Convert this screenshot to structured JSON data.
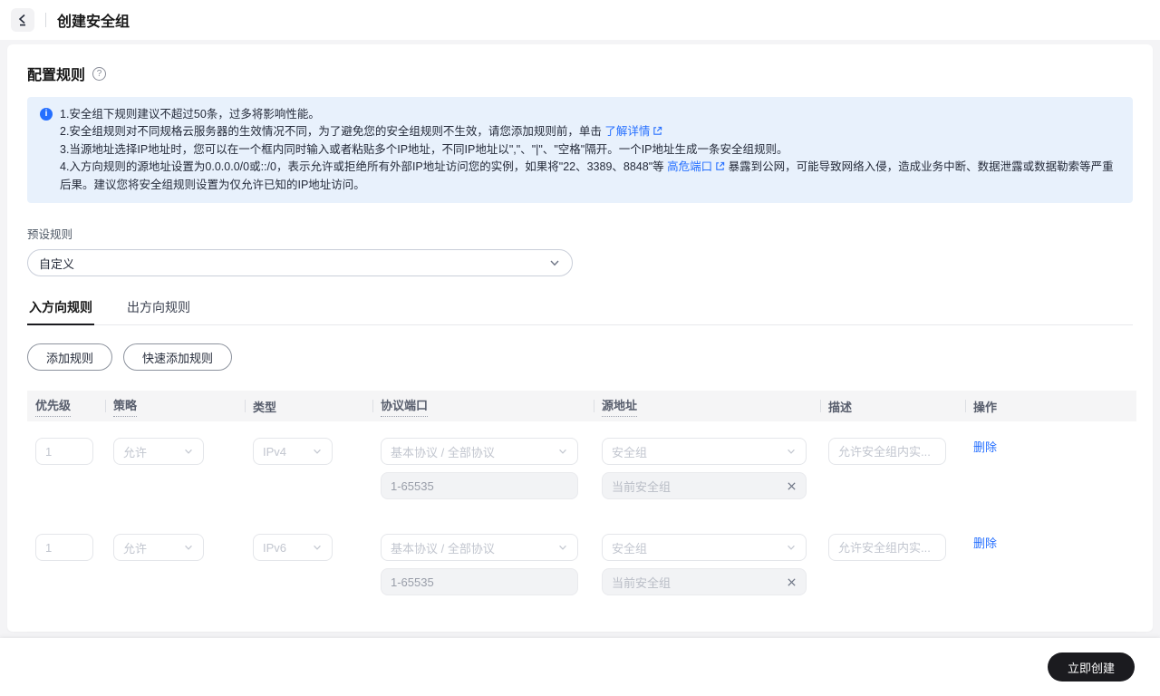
{
  "header": {
    "title": "创建安全组"
  },
  "panel": {
    "title": "配置规则",
    "help_icon_glyph": "?",
    "notice": {
      "line1": "1.安全组下规则建议不超过50条，过多将影响性能。",
      "line2_text": "2.安全组规则对不同规格云服务器的生效情况不同，为了避免您的安全组规则不生效，请您添加规则前，单击",
      "line2_link": "了解详情",
      "line3": "3.当源地址选择IP地址时，您可以在一个框内同时输入或者粘贴多个IP地址，不同IP地址以\",\"、\"|\"、\"空格\"隔开。一个IP地址生成一条安全组规则。",
      "line4_text": "4.入方向规则的源地址设置为0.0.0.0/0或::/0，表示允许或拒绝所有外部IP地址访问您的实例，如果将\"22、3389、8848\"等",
      "line4_link": "高危端口",
      "line4_suffix": "暴露到公网，可能导致网络入侵，造成业务中断、数据泄露或数据勒索等严重后果。建议您将安全组规则设置为仅允许已知的IP地址访问。"
    },
    "preset": {
      "label": "预设规则",
      "value": "自定义"
    },
    "tabs": {
      "inbound": "入方向规则",
      "outbound": "出方向规则"
    },
    "buttons": {
      "add": "添加规则",
      "quick_add": "快速添加规则"
    },
    "table": {
      "columns": {
        "priority": "优先级",
        "policy": "策略",
        "type": "类型",
        "protocol_port": "协议端口",
        "source": "源地址",
        "description": "描述",
        "operation": "操作"
      },
      "rows": [
        {
          "priority": "1",
          "policy": "允许",
          "type": "IPv4",
          "protocol": "基本协议 / 全部协议",
          "port": "1-65535",
          "source_type": "安全组",
          "source_tag": "当前安全组",
          "description_placeholder": "允许安全组内实...",
          "action": "删除"
        },
        {
          "priority": "1",
          "policy": "允许",
          "type": "IPv6",
          "protocol": "基本协议 / 全部协议",
          "port": "1-65535",
          "source_type": "安全组",
          "source_tag": "当前安全组",
          "description_placeholder": "允许安全组内实...",
          "action": "删除"
        }
      ]
    }
  },
  "footer": {
    "create_button": "立即创建"
  },
  "colors": {
    "link_blue": "#256fff",
    "notice_bg": "#e8f1fc",
    "create_button_bg": "#1b1b1f",
    "page_bg": "#f4f4f6",
    "table_header_bg": "#f5f5f6"
  }
}
